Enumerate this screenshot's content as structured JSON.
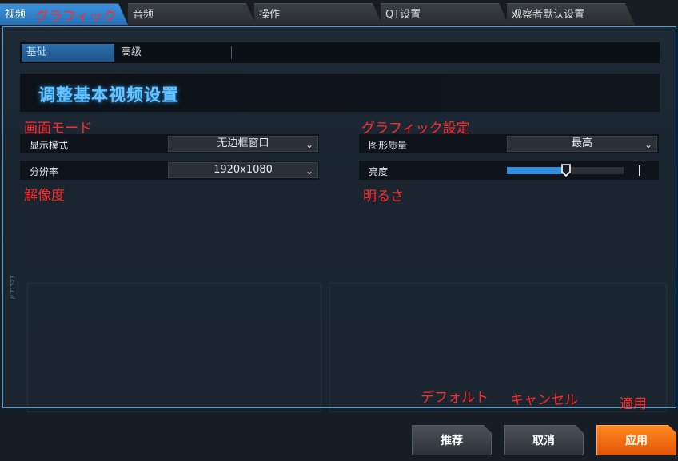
{
  "tabs": [
    {
      "label": "视频",
      "active": true
    },
    {
      "label": "音频"
    },
    {
      "label": "操作"
    },
    {
      "label": "QT设置"
    },
    {
      "label": "观察者默认设置"
    }
  ],
  "subtabs": [
    {
      "label": "基础",
      "active": true
    },
    {
      "label": "高级"
    }
  ],
  "header": {
    "title": "调整基本视频设置"
  },
  "left": {
    "display_mode": {
      "label": "显示模式",
      "value": "无边框窗口"
    },
    "resolution": {
      "label": "分辨率",
      "value": "1920x1080"
    }
  },
  "right": {
    "graphics_quality": {
      "label": "图形质量",
      "value": "最高"
    },
    "brightness": {
      "label": "亮度",
      "level_fraction": 0.51
    }
  },
  "annotations": {
    "graphics_tab": "グラフィック",
    "screen_mode": "画面モード",
    "resolution": "解像度",
    "graphics_settings": "グラフィック設定",
    "brightness": "明るさ",
    "default": "デフォルト",
    "cancel": "キャンセル",
    "apply": "適用"
  },
  "buttons": {
    "recommend": "推荐",
    "cancel": "取消",
    "apply": "应用"
  },
  "side_mark": "// 71523",
  "colors": {
    "accent": "#2f8fdc",
    "apply": "#f26d12",
    "annotation": "#ff2b2b"
  }
}
